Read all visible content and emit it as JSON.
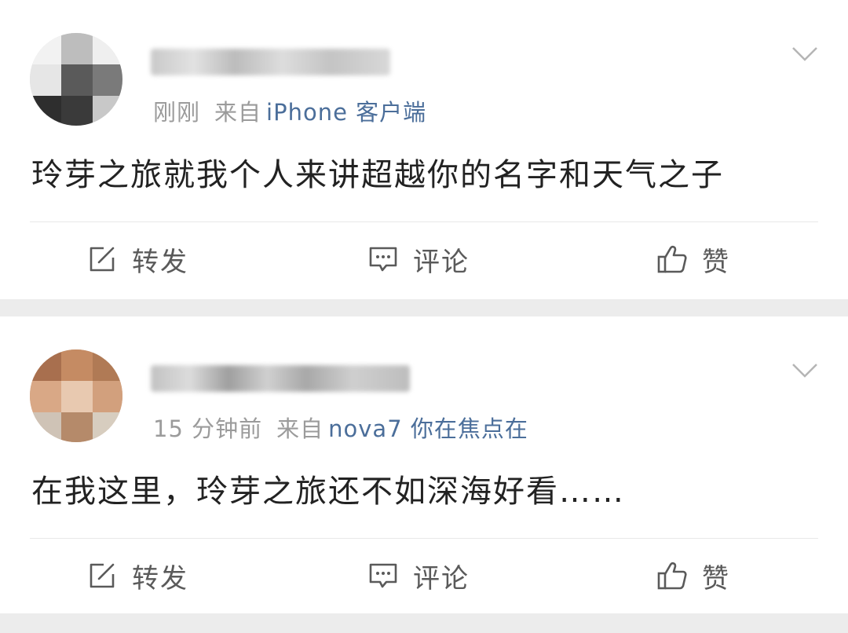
{
  "posts": [
    {
      "time": "刚刚",
      "from_label": "来自",
      "source": "iPhone 客户端",
      "text": "玲芽之旅就我个人来讲超越你的名字和天气之子"
    },
    {
      "time": "15 分钟前",
      "from_label": "来自",
      "source": "nova7 你在焦点在",
      "text": "在我这里，玲芽之旅还不如深海好看……"
    }
  ],
  "actions": {
    "repost": "转发",
    "comment": "评论",
    "like": "赞"
  },
  "icons": {
    "repost": "edit-square-icon",
    "comment": "comment-bubble-icon",
    "like": "thumbs-up-icon",
    "menu": "chevron-down-icon"
  },
  "colors": {
    "source_link": "#4b6e9a",
    "meta_gray": "#9b9b9b",
    "text": "#222222",
    "page_bg": "#ececec"
  }
}
